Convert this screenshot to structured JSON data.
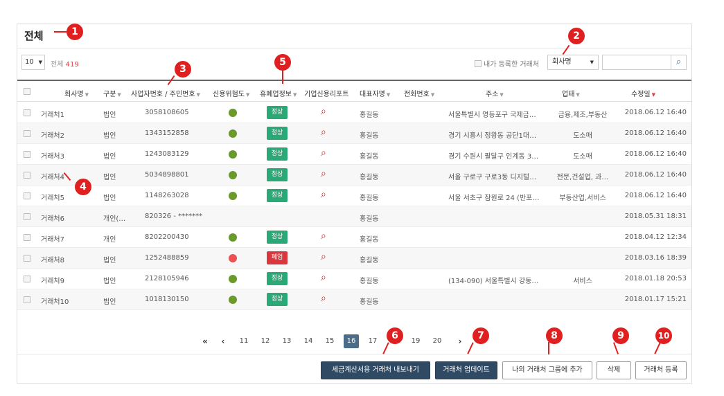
{
  "title": "전체",
  "toolbar": {
    "page_size": "10",
    "total_label": "전체",
    "total_count": "419",
    "my_clients_label": "내가 등록한 거래처",
    "search_field": "회사명",
    "search_placeholder": ""
  },
  "columns": [
    "회사명",
    "구분",
    "사업자번호 / 주민번호",
    "신용위험도",
    "휴폐업정보",
    "기업신용리포트",
    "대표자명",
    "전화번호",
    "주소",
    "업태",
    "수정일"
  ],
  "rows": [
    {
      "name": "거래처1",
      "type": "법인",
      "reg": "3058108605",
      "risk": "green",
      "status": "정상",
      "ceo": "홍길동",
      "addr": "서울특별시 영등포구 국제금…",
      "biz": "금융,제조,부동산",
      "date": "2018.06.12 16:40"
    },
    {
      "name": "거래처2",
      "type": "법인",
      "reg": "1343152858",
      "risk": "green",
      "status": "정상",
      "ceo": "홍길동",
      "addr": "경기 시흥시 정왕동 공단1대…",
      "biz": "도소매",
      "date": "2018.06.12 16:40"
    },
    {
      "name": "거래처3",
      "type": "법인",
      "reg": "1243083129",
      "risk": "green",
      "status": "정상",
      "ceo": "홍길동",
      "addr": "경기 수원시 팔달구 인계동 3…",
      "biz": "도소매",
      "date": "2018.06.12 16:40"
    },
    {
      "name": "거래처4",
      "type": "법인",
      "reg": "5034898801",
      "risk": "green",
      "status": "정상",
      "ceo": "홍길동",
      "addr": "서울 구로구 구로3동 디지털…",
      "biz": "전문,건설업, 과…",
      "date": "2018.06.12 16:40"
    },
    {
      "name": "거래처5",
      "type": "법인",
      "reg": "1148263028",
      "risk": "green",
      "status": "정상",
      "ceo": "홍길동",
      "addr": "서울 서초구 잠원로 24 (반포…",
      "biz": "부동산업,서비스",
      "date": "2018.06.12 16:40"
    },
    {
      "name": "거래처6",
      "type": "개인(…",
      "reg": "820326 - *******",
      "risk": "",
      "status": "",
      "ceo": "홍길동",
      "addr": "",
      "biz": "",
      "date": "2018.05.31 18:31"
    },
    {
      "name": "거래처7",
      "type": "개인",
      "reg": "8202200430",
      "risk": "green",
      "status": "정상",
      "ceo": "홍길동",
      "addr": "",
      "biz": "",
      "date": "2018.04.12 12:34"
    },
    {
      "name": "거래처8",
      "type": "법인",
      "reg": "1252488859",
      "risk": "red",
      "status": "폐업",
      "ceo": "홍길동",
      "addr": "",
      "biz": "",
      "date": "2018.03.16 18:39"
    },
    {
      "name": "거래처9",
      "type": "법인",
      "reg": "2128105946",
      "risk": "green",
      "status": "정상",
      "ceo": "홍길동",
      "addr": "(134-090) 서울특별시 강동…",
      "biz": "서비스",
      "date": "2018.01.18 20:53"
    },
    {
      "name": "거래처10",
      "type": "법인",
      "reg": "1018130150",
      "risk": "green",
      "status": "정상",
      "ceo": "홍길동",
      "addr": "",
      "biz": "",
      "date": "2018.01.17 15:21"
    }
  ],
  "pagination": {
    "first": "«",
    "prev": "‹",
    "pages": [
      "11",
      "12",
      "13",
      "14",
      "15",
      "16",
      "17",
      "18",
      "19",
      "20"
    ],
    "active": "16",
    "next": "›"
  },
  "buttons": {
    "export": "세금계산서용 거래처 내보내기",
    "update": "거래처 업데이트",
    "add_group": "나의 거래처 그룹에 추가",
    "delete": "삭제",
    "register": "거래처 등록"
  },
  "markers": [
    "1",
    "2",
    "3",
    "4",
    "5",
    "6",
    "7",
    "8",
    "9",
    "10"
  ],
  "colors": {
    "status_normal": "#2aa876",
    "status_closed": "#d9363e",
    "risk_green": "#6a9a2c",
    "risk_red": "#ec5252",
    "marker": "#e02020",
    "dark_button": "#314a63",
    "active_page": "#4b6d8a"
  },
  "icons": {
    "search": "search-icon",
    "report": "magnifier-icon",
    "sort": "triangle-down-icon"
  }
}
